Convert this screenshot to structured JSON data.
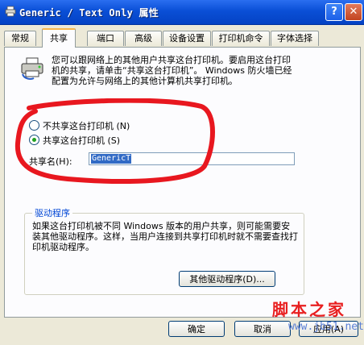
{
  "window": {
    "title": "Generic / Text Only 属性",
    "help_glyph": "?",
    "close_glyph": "✕"
  },
  "tabs": [
    "常规",
    "共享",
    "端口",
    "高级",
    "设备设置",
    "打印机命令",
    "字体选择"
  ],
  "active_tab": "共享",
  "sharing": {
    "description": "您可以跟网络上的其他用户共享这台打印机。要启用这台打印机的共享，请单击“共享这台打印机”。 Windows 防火墙已经配置为允许与网络上的其他计算机共享打印机。",
    "option_not_shared": "不共享这台打印机 (N)",
    "option_shared": "共享这台打印机 (S)",
    "selected": "option_shared",
    "share_name_label": "共享名(H):",
    "share_name_value": "GenericT"
  },
  "drivers": {
    "group_title": "驱动程序",
    "text": "如果这台打印机被不同 Windows 版本的用户共享，则可能需要安装其他驱动程序。这样，当用户连接到共享打印机时就不需要查找打印机驱动程序。",
    "button": "其他驱动程序(D)..."
  },
  "footer": {
    "ok": "确定",
    "cancel": "取消",
    "apply": "应用(A)"
  },
  "watermark": {
    "text": "脚本之家",
    "url": "www.jb51.net"
  },
  "colors": {
    "title_bar": "#0a4fd6",
    "tab_highlight": "#f6b54b",
    "annotation_circle": "#e8171f",
    "group_title": "#0046d5"
  }
}
